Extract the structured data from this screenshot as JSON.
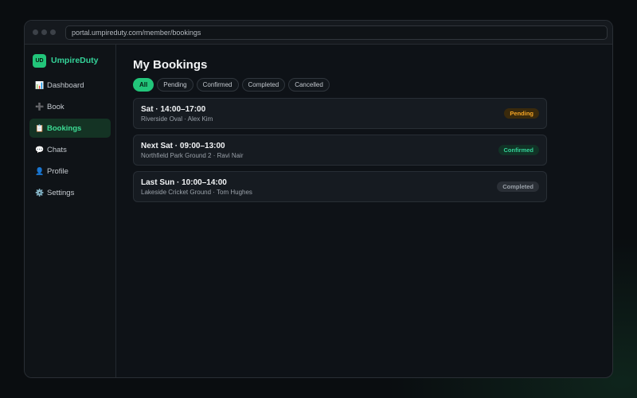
{
  "browser": {
    "url": "portal.umpireduty.com/member/bookings"
  },
  "brand": {
    "logo_text": "UD",
    "name": "UmpireDuty"
  },
  "sidebar": {
    "items": [
      {
        "label": "Dashboard",
        "icon": "📊",
        "icon_name": "chart-icon"
      },
      {
        "label": "Book",
        "icon": "➕",
        "icon_name": "plus-icon"
      },
      {
        "label": "Bookings",
        "icon": "📋",
        "icon_name": "clipboard-icon",
        "active": true
      },
      {
        "label": "Chats",
        "icon": "💬",
        "icon_name": "chat-bubble-icon"
      },
      {
        "label": "Profile",
        "icon": "👤",
        "icon_name": "user-icon"
      },
      {
        "label": "Settings",
        "icon": "⚙️",
        "icon_name": "gear-icon"
      }
    ]
  },
  "main": {
    "title": "My Bookings",
    "filters": [
      "All",
      "Pending",
      "Confirmed",
      "Completed",
      "Cancelled"
    ],
    "active_filter": "All"
  },
  "bookings": [
    {
      "when": "Sat · 14:00–17:00",
      "details": "Riverside Oval · Alex Kim",
      "status": "Pending"
    },
    {
      "when": "Next Sat · 09:00–13:00",
      "details": "Northfield Park Ground 2 · Ravi Nair",
      "status": "Confirmed"
    },
    {
      "when": "Last Sun · 10:00–14:00",
      "details": "Lakeside Cricket Ground · Tom Hughes",
      "status": "Completed"
    }
  ],
  "colors": {
    "accent": "#22c57a",
    "pending_text": "#f5a524",
    "pending_bg": "#3a2a0c",
    "confirmed_text": "#34d399",
    "confirmed_bg": "#113326",
    "completed_text": "#9aa1a9",
    "completed_bg": "#2a2f36"
  }
}
